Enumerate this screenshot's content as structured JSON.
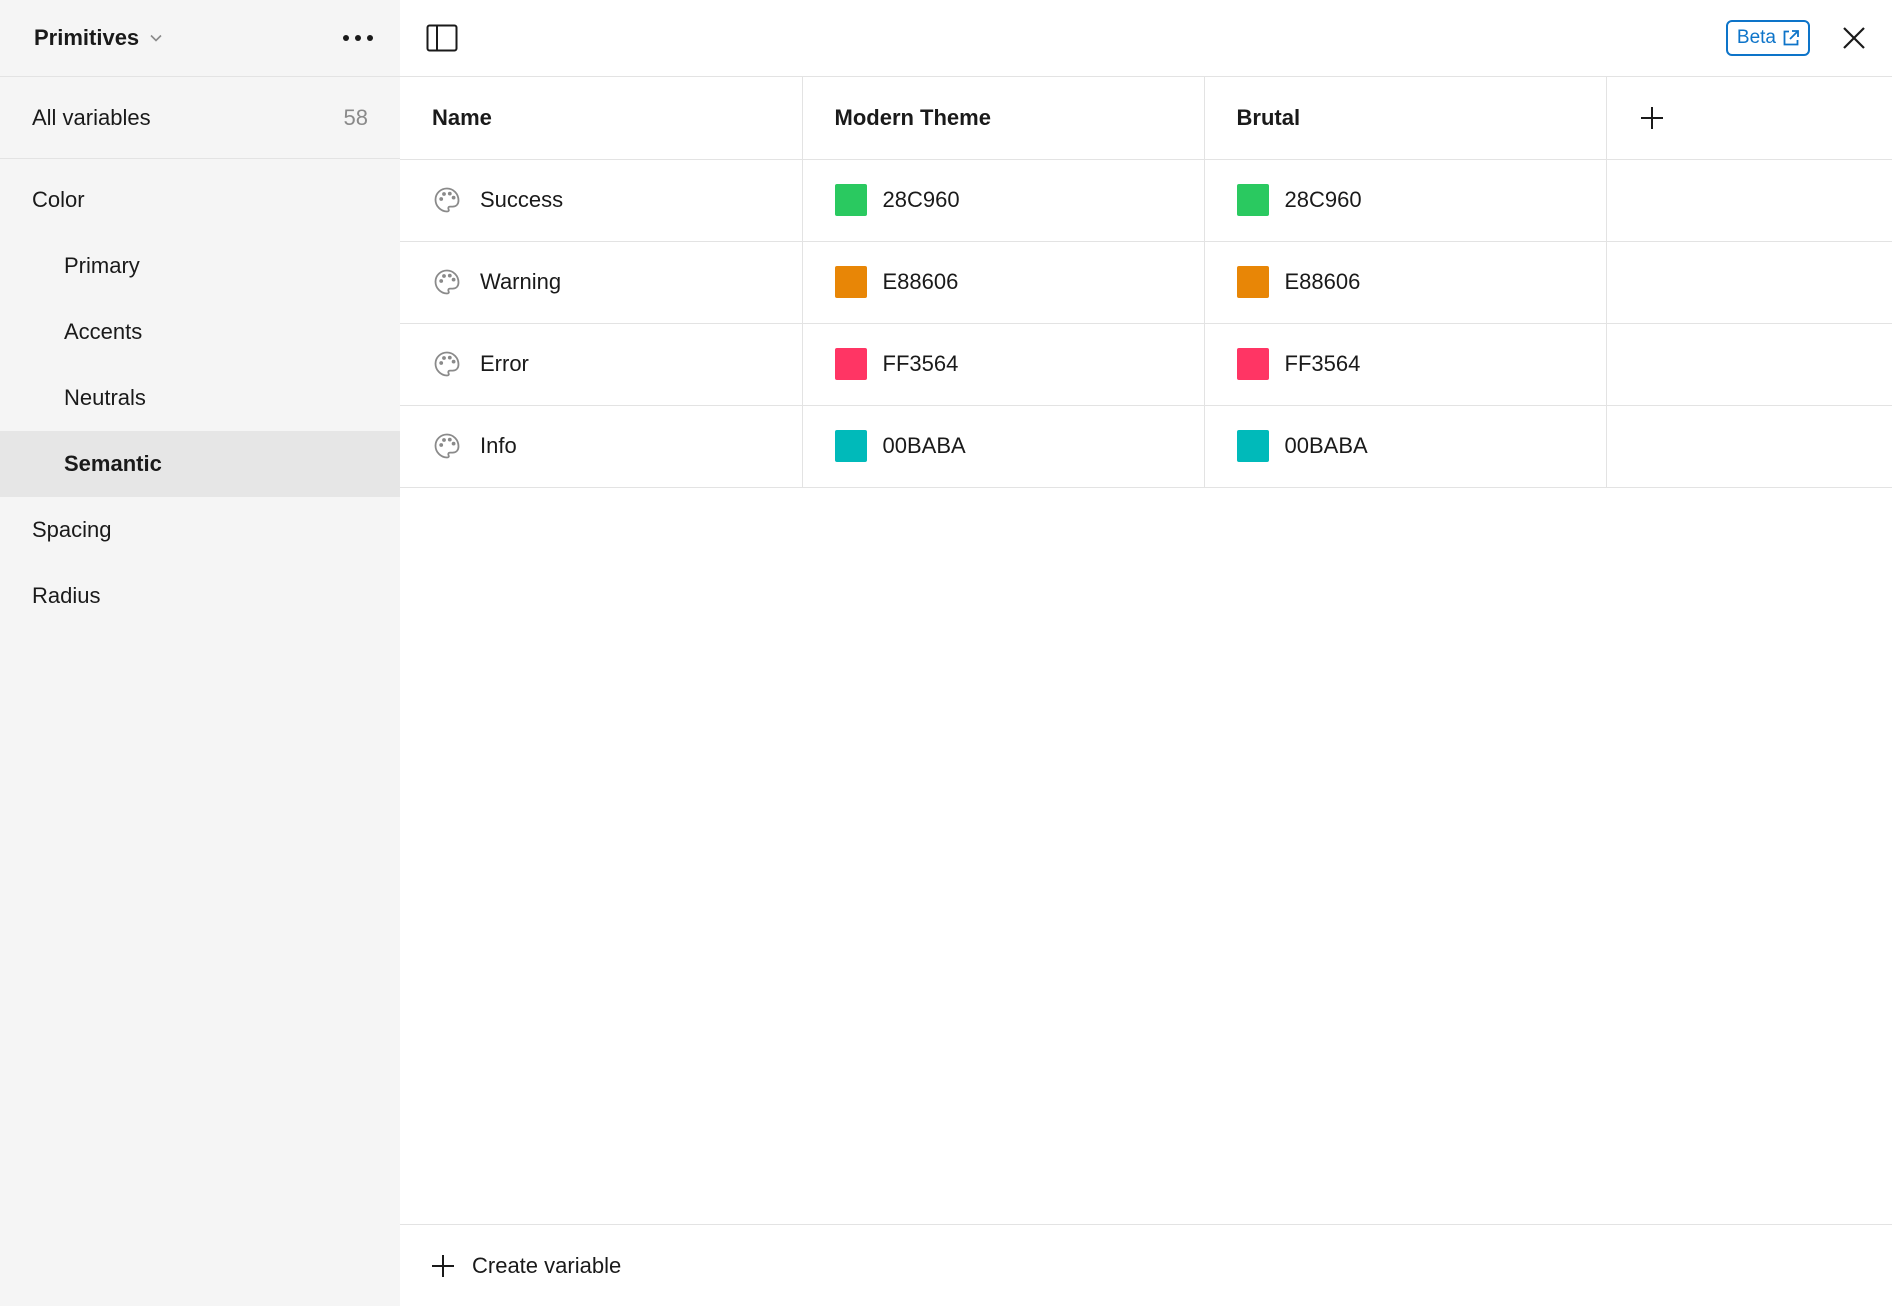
{
  "sidebar": {
    "collection_title": "Primitives",
    "all_variables_label": "All variables",
    "all_variables_count": "58",
    "groups": [
      {
        "label": "Color",
        "level": 0
      },
      {
        "label": "Primary",
        "level": 1
      },
      {
        "label": "Accents",
        "level": 1
      },
      {
        "label": "Neutrals",
        "level": 1
      },
      {
        "label": "Semantic",
        "level": 1,
        "active": true
      },
      {
        "label": "Spacing",
        "level": 0
      },
      {
        "label": "Radius",
        "level": 0
      }
    ]
  },
  "topbar": {
    "beta_label": "Beta",
    "icons": [
      "panel-toggle-icon",
      "external-link-icon",
      "close-icon"
    ]
  },
  "table": {
    "headers": [
      "Name",
      "Modern Theme",
      "Brutal"
    ],
    "rows": [
      {
        "name": "Success",
        "values": [
          {
            "hex": "28C960",
            "color": "#2AC960"
          },
          {
            "hex": "28C960",
            "color": "#2AC960"
          }
        ]
      },
      {
        "name": "Warning",
        "values": [
          {
            "hex": "E88606",
            "color": "#E88606"
          },
          {
            "hex": "E88606",
            "color": "#E88606"
          }
        ]
      },
      {
        "name": "Error",
        "values": [
          {
            "hex": "FF3564",
            "color": "#FF3564"
          },
          {
            "hex": "FF3564",
            "color": "#FF3564"
          }
        ]
      },
      {
        "name": "Info",
        "values": [
          {
            "hex": "00BABA",
            "color": "#00BABA"
          },
          {
            "hex": "00BABA",
            "color": "#00BABA"
          }
        ]
      }
    ]
  },
  "footer": {
    "create_label": "Create variable"
  },
  "colors": {
    "accent": "#0D74C9",
    "sidebar_bg": "#F5F5F5",
    "active_row_bg": "#E6E6E6",
    "border": "#E3E3E3"
  }
}
